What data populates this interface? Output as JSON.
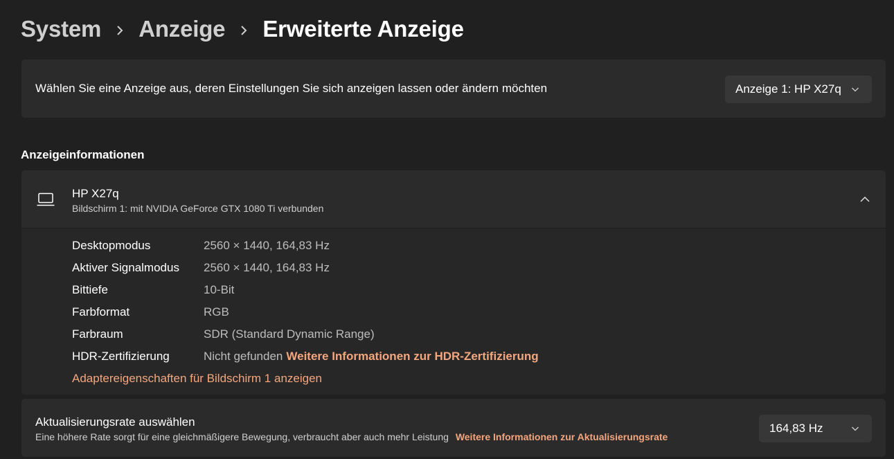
{
  "breadcrumb": {
    "items": [
      "System",
      "Anzeige"
    ],
    "current": "Erweiterte Anzeige"
  },
  "select_display": {
    "label": "Wählen Sie eine Anzeige aus, deren Einstellungen Sie sich anzeigen lassen oder ändern möchten",
    "selected": "Anzeige 1: HP X27q"
  },
  "display_info": {
    "section_title": "Anzeigeinformationen",
    "monitor_name": "HP X27q",
    "monitor_subtitle": "Bildschirm 1: mit NVIDIA GeForce GTX 1080 Ti verbunden",
    "rows": [
      {
        "label": "Desktopmodus",
        "value": "2560 × 1440, 164,83 Hz"
      },
      {
        "label": "Aktiver Signalmodus",
        "value": "2560 × 1440, 164,83 Hz"
      },
      {
        "label": "Bittiefe",
        "value": "10-Bit"
      },
      {
        "label": "Farbformat",
        "value": "RGB"
      },
      {
        "label": "Farbraum",
        "value": "SDR (Standard Dynamic Range)"
      }
    ],
    "hdr": {
      "label": "HDR-Zertifizierung",
      "value": "Nicht gefunden",
      "link": "Weitere Informationen zur HDR-Zertifizierung"
    },
    "adapter_link": "Adaptereigenschaften für Bildschirm 1 anzeigen"
  },
  "refresh_rate": {
    "title": "Aktualisierungsrate auswählen",
    "description": "Eine höhere Rate sorgt für eine gleichmäßigere Bewegung, verbraucht aber auch mehr Leistung",
    "link": "Weitere Informationen zur Aktualisierungsrate",
    "selected": "164,83 Hz"
  },
  "colors": {
    "background": "#202020",
    "card": "#2b2b2b",
    "accent_link": "#f4a67e"
  },
  "icons": [
    "chevron-right-icon",
    "chevron-down-icon",
    "laptop-icon",
    "chevron-up-icon"
  ]
}
